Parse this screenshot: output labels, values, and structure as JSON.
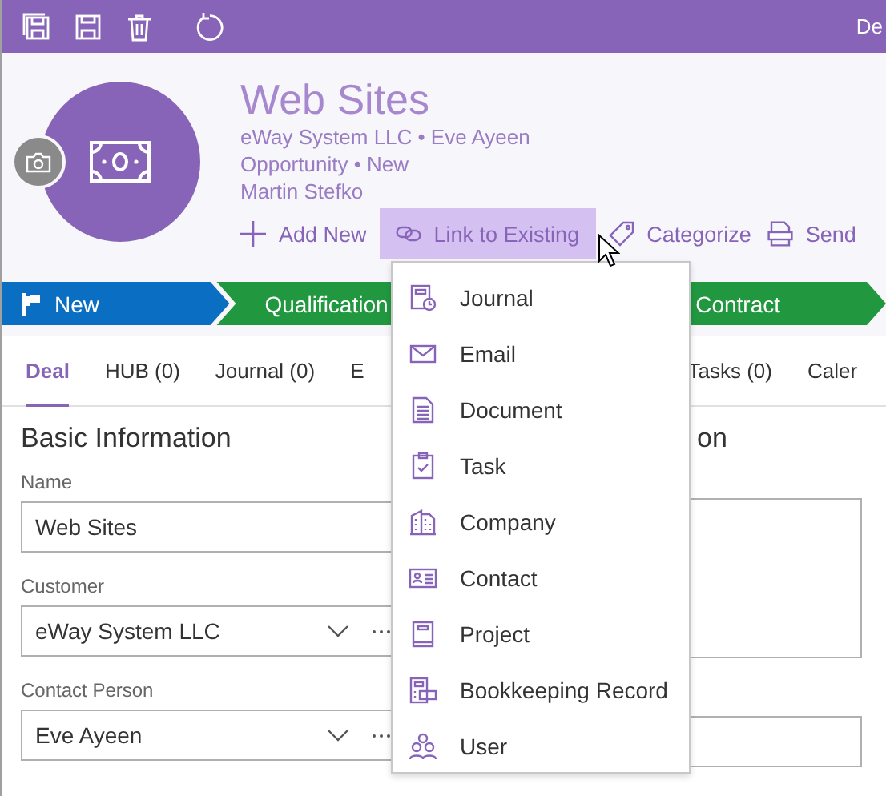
{
  "top_bar": {
    "user": "De"
  },
  "header": {
    "title": "Web Sites",
    "subtitle_lines": [
      "eWay System LLC • Eve Ayeen",
      "Opportunity • New",
      "Martin Stefko"
    ],
    "actions": [
      {
        "label": "Add New",
        "kind": "add",
        "selected": false
      },
      {
        "label": "Link to Existing",
        "kind": "link",
        "selected": true
      },
      {
        "label": "Categorize",
        "kind": "tag",
        "selected": false
      },
      {
        "label": "Send",
        "kind": "pdf",
        "selected": false
      }
    ]
  },
  "stages": [
    {
      "label": "New",
      "color": "#0a6fc2",
      "flag": true
    },
    {
      "label": "Qualification",
      "color": "#21983f",
      "flag": false
    },
    {
      "label": "Contract",
      "color": "#21983f",
      "flag": false
    }
  ],
  "tabs": [
    {
      "label": "Deal",
      "selected": true
    },
    {
      "label": "HUB (0)",
      "selected": false
    },
    {
      "label": "Journal (0)",
      "selected": false
    },
    {
      "label": "E",
      "selected": false
    },
    {
      "label": "Tasks (0)",
      "selected": false
    },
    {
      "label": "Caler",
      "selected": false
    }
  ],
  "left_section": {
    "heading": "Basic Information",
    "fields": [
      {
        "label": "Name",
        "value": "Web Sites",
        "kind": "text"
      },
      {
        "label": "Customer",
        "value": "eWay System LLC",
        "kind": "lookup"
      },
      {
        "label": "Contact Person",
        "value": "Eve Ayeen",
        "kind": "lookup"
      }
    ]
  },
  "right_section": {
    "heading": "on"
  },
  "dropdown_menu": {
    "items": [
      {
        "label": "Journal",
        "kind": "journal"
      },
      {
        "label": "Email",
        "kind": "email"
      },
      {
        "label": "Document",
        "kind": "document"
      },
      {
        "label": "Task",
        "kind": "task"
      },
      {
        "label": "Company",
        "kind": "company"
      },
      {
        "label": "Contact",
        "kind": "contact"
      },
      {
        "label": "Project",
        "kind": "project"
      },
      {
        "label": "Bookkeeping Record",
        "kind": "bookkeeping"
      },
      {
        "label": "User",
        "kind": "user"
      }
    ]
  }
}
